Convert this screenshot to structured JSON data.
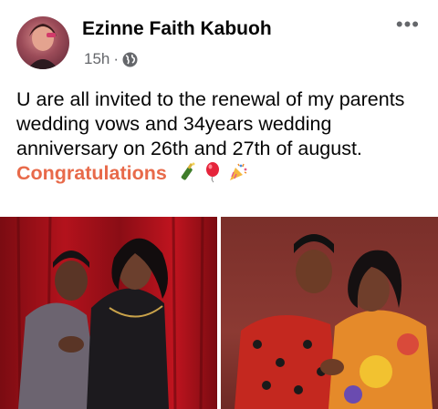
{
  "post": {
    "author": "Ezinne Faith Kabuoh",
    "time": "15h",
    "separator": "·",
    "more_icon": "more-horizontal-icon",
    "privacy_icon": "globe-icon",
    "text": "U are all invited to the renewal of my parents wedding vows and 34years wedding anniversary on 26th and 27th of august. ",
    "highlight": "Congratulations",
    "highlight_color": "#e86a4a",
    "emojis": [
      "champagne-bottle-icon",
      "red-balloon-icon",
      "party-popper-icon"
    ]
  },
  "photos": [
    {
      "name": "couple-photo-red-curtain"
    },
    {
      "name": "couple-photo-traditional-attire"
    }
  ]
}
